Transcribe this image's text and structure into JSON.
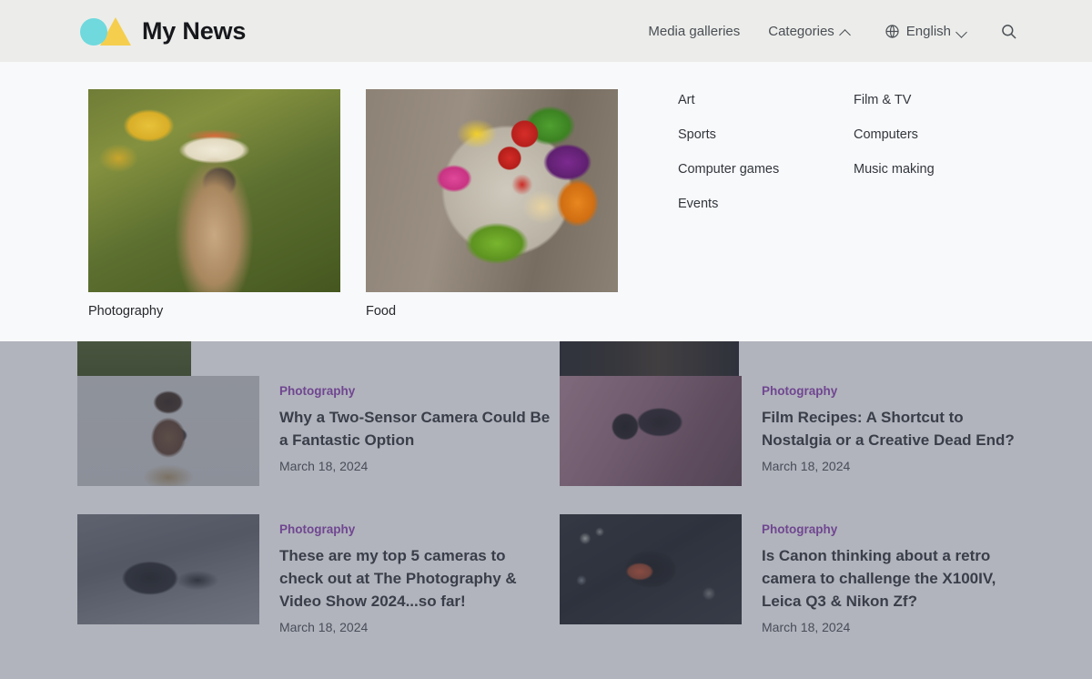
{
  "header": {
    "brand_title": "My News",
    "logo": {
      "circle_color": "#6fd9dd",
      "triangle_color": "#f5ce4e"
    },
    "nav": [
      {
        "label": "Media galleries",
        "icon": "",
        "chevron": ""
      },
      {
        "label": "Categories",
        "icon": "",
        "chevron": "chevron-up-icon"
      },
      {
        "label": "English",
        "icon": "globe-icon",
        "chevron": "chevron-down-icon"
      }
    ],
    "search_icon": "search-icon"
  },
  "dropdown": {
    "featured": [
      {
        "label": "Photography",
        "image": "woman-photographer-sunflowers"
      },
      {
        "label": "Food",
        "image": "salad-bowl-on-wood"
      }
    ],
    "categories_col1": [
      {
        "label": "Art"
      },
      {
        "label": "Sports"
      },
      {
        "label": "Computer games"
      },
      {
        "label": "Events"
      }
    ],
    "categories_col2": [
      {
        "label": "Film & TV"
      },
      {
        "label": "Computers"
      },
      {
        "label": "Music making"
      }
    ]
  },
  "articles": [
    {
      "category": "Photography",
      "title": "Why a Two-Sensor Camera Could Be a Fantastic Option",
      "date": "March 18, 2024",
      "image": "portrait-person-with-camera"
    },
    {
      "category": "Photography",
      "title": "Film Recipes: A Shortcut to Nostalgia or a Creative Dead End?",
      "date": "March 18, 2024",
      "image": "dslr-on-tripod-pink"
    },
    {
      "category": "Photography",
      "title": "These are my top 5 cameras to check out at The Photography & Video Show 2024...so far!",
      "date": "March 18, 2024",
      "image": "black-and-white-dslr-on-desk"
    },
    {
      "category": "Photography",
      "title": "Is Canon thinking about a retro camera to challenge the X100IV, Leica Q3 & Nikon Zf?",
      "date": "March 18, 2024",
      "image": "camera-lcd-night-bokeh"
    }
  ],
  "colors": {
    "header_bg": "#ecedea",
    "dropdown_bg": "#f8f9fb",
    "category_link": "#8e3fb4",
    "scrim": "#9499a3",
    "title_text": "#2c3036"
  }
}
